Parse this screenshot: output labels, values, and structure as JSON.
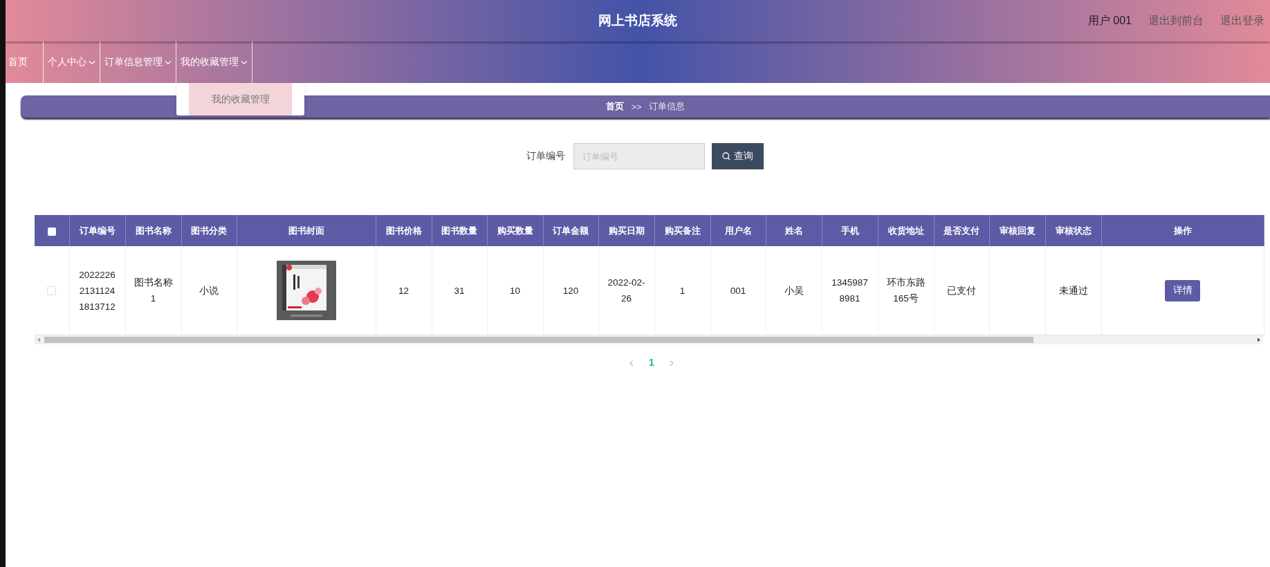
{
  "header": {
    "title": "网上书店系统",
    "user": "用户 001",
    "links": [
      "退出到前台",
      "退出登录"
    ]
  },
  "nav": [
    {
      "label": "首页",
      "dropdown": false
    },
    {
      "label": "个人中心",
      "dropdown": true
    },
    {
      "label": "订单信息管理",
      "dropdown": true
    },
    {
      "label": "我的收藏管理",
      "dropdown": true,
      "menu": [
        {
          "label": "我的收藏管理",
          "highlighted": true
        }
      ]
    }
  ],
  "breadcrumb": {
    "items": [
      "首页",
      "订单信息"
    ],
    "separator": ">>"
  },
  "search": {
    "label": "订单编号",
    "placeholder": "订单编号",
    "button": "查询"
  },
  "table": {
    "header_checked": false,
    "columns": [
      "订单编号",
      "图书名称",
      "图书分类",
      "图书封面",
      "图书价格",
      "图书数量",
      "购买数量",
      "订单金额",
      "购买日期",
      "购买备注",
      "用户名",
      "姓名",
      "手机",
      "收货地址",
      "是否支付",
      "审核回复",
      "审核状态",
      "操作"
    ],
    "rows": [
      {
        "selected": false,
        "cells": [
          {
            "kind": "text",
            "text": "202222621311241813712"
          },
          {
            "kind": "text",
            "text": "图书名称1"
          },
          {
            "kind": "text",
            "text": "小说"
          },
          {
            "kind": "picture"
          },
          {
            "kind": "text",
            "text": "12"
          },
          {
            "kind": "text",
            "text": "31"
          },
          {
            "kind": "text",
            "text": "10"
          },
          {
            "kind": "text",
            "text": "120"
          },
          {
            "kind": "text",
            "text": "2022-02-26"
          },
          {
            "kind": "text",
            "text": "1"
          },
          {
            "kind": "text",
            "text": "001"
          },
          {
            "kind": "text",
            "text": "小吴"
          },
          {
            "kind": "text",
            "text": "13459878981"
          },
          {
            "kind": "text",
            "text": "环市东路165号"
          },
          {
            "kind": "text",
            "text": "已支付"
          },
          {
            "kind": "blank"
          },
          {
            "kind": "text",
            "text": "未通过"
          },
          {
            "kind": "button",
            "text": "详情"
          }
        ]
      }
    ]
  },
  "pagination": {
    "prev": "‹",
    "next": "›",
    "pages": [
      {
        "label": "1",
        "selected": true
      }
    ]
  }
}
